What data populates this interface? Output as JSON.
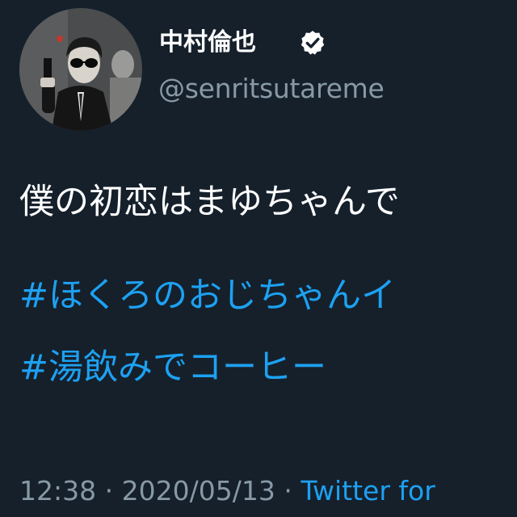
{
  "author": {
    "display_name": "中村倫也",
    "handle": "@senritsutareme",
    "verified": true
  },
  "tweet": {
    "text": "僕の初恋はまゆちゃんで",
    "hashtags": [
      "#ほくろのおじちゃんイ",
      "#湯飲みでコーヒー"
    ],
    "time": "12:38",
    "separator": "·",
    "date": "2020/05/13",
    "source": "Twitter for"
  },
  "icons": {
    "verified": "verified-badge-icon",
    "avatar": "profile-photo"
  },
  "colors": {
    "background": "#15202b",
    "text": "#ffffff",
    "secondary": "#8899a6",
    "accent": "#1da1f2"
  }
}
